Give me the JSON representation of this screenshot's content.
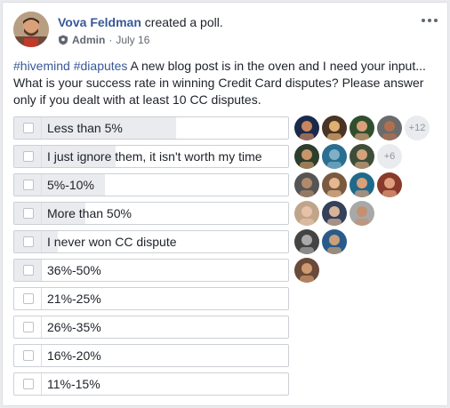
{
  "post": {
    "author": "Vova Feldman",
    "action": "created a poll.",
    "role": "Admin",
    "separator": "·",
    "date": "July 16",
    "more_icon": "ellipsis-icon",
    "hashtags": [
      "#hivemind",
      "#diaputes"
    ],
    "body": " A new blog post is in the oven and I need your input... What is your success rate in winning Credit Card disputes? Please answer only if you dealt with at least 10 CC disputes."
  },
  "poll": {
    "options": [
      {
        "label": "Less than 5%",
        "fill": 0.59,
        "more": "+12"
      },
      {
        "label": "I just ignore them, it isn't worth my time",
        "fill": 0.37,
        "more": "+6"
      },
      {
        "label": "5%-10%",
        "fill": 0.33,
        "more": ""
      },
      {
        "label": "More than 50%",
        "fill": 0.26,
        "more": ""
      },
      {
        "label": "I never won CC dispute",
        "fill": 0.16,
        "more": ""
      },
      {
        "label": "36%-50%",
        "fill": 0.1,
        "more": ""
      },
      {
        "label": "21%-25%",
        "fill": 0,
        "more": ""
      },
      {
        "label": "26%-35%",
        "fill": 0,
        "more": ""
      },
      {
        "label": "16%-20%",
        "fill": 0,
        "more": ""
      },
      {
        "label": "11%-15%",
        "fill": 0,
        "more": ""
      }
    ]
  },
  "colors": {
    "link": "#385898",
    "bar_fill": "#e9ebee",
    "border": "#ccd0d5"
  }
}
